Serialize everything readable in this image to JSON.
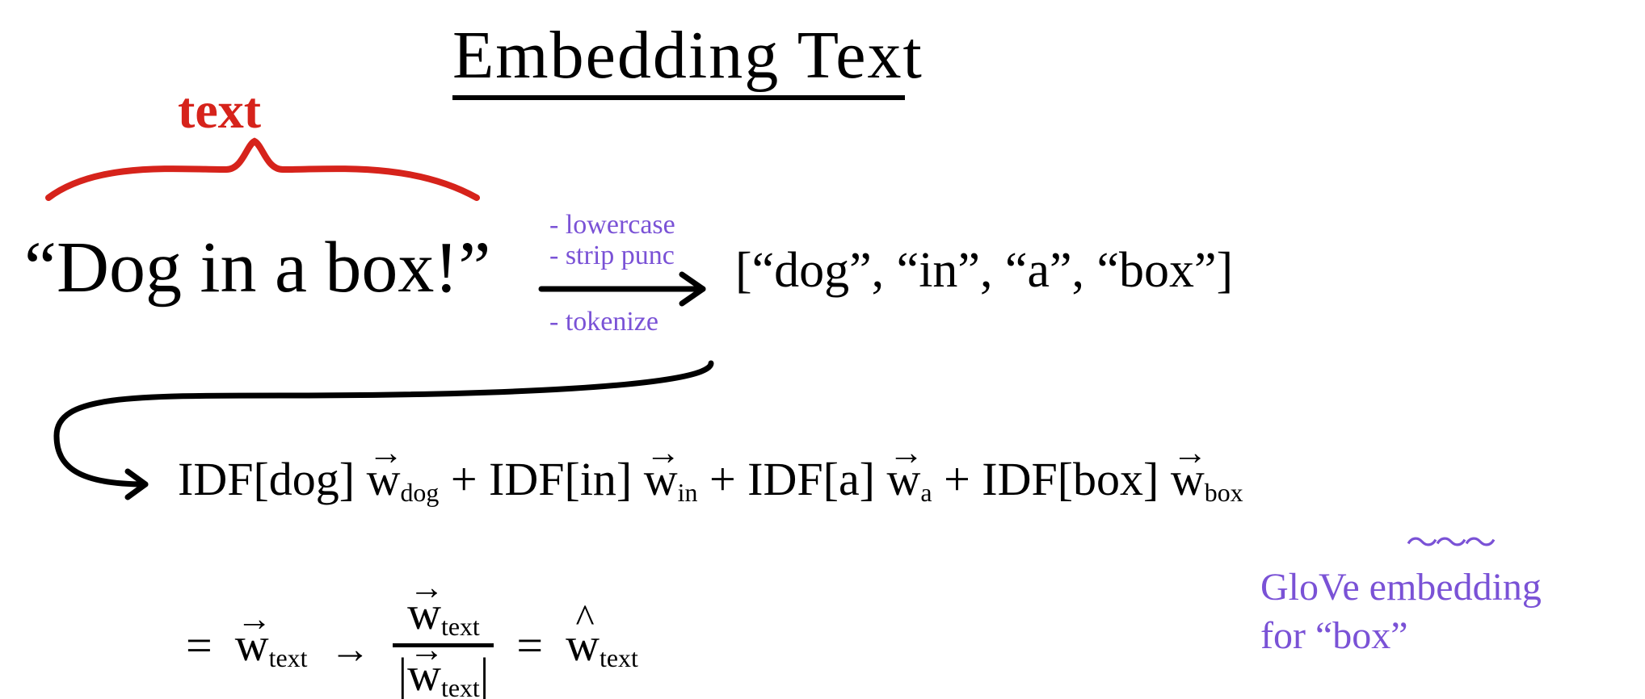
{
  "title": "Embedding Text",
  "label_text": "text",
  "input_phrase": "“Dog in a box!”",
  "processing": {
    "step1": "- lowercase",
    "step2": "- strip punc",
    "step3": "- tokenize"
  },
  "tokens_display": "[“dog”, “in”, “a”, “box”]",
  "tokens": [
    "dog",
    "in",
    "a",
    "box"
  ],
  "formula": {
    "idf_prefix": "IDF",
    "weight_symbol": "w̅",
    "terms": [
      "dog",
      "in",
      "a",
      "box"
    ],
    "plus": " + ",
    "result_name": "text"
  },
  "formula_line1_parts": {
    "t1a": "IDF[dog] ",
    "t1b": "w",
    "t1c": "dog",
    "t2a": "IDF[in] ",
    "t2b": "w",
    "t2c": "in",
    "t3a": "IDF[a] ",
    "t3b": "w",
    "t3c": "a",
    "t4a": "IDF[box] ",
    "t4b": "w",
    "t4c": "box"
  },
  "formula_line2": {
    "eq": "=",
    "w": "w",
    "text_sub": "text",
    "arrow": "→",
    "abs_open": "|",
    "abs_close": "|"
  },
  "annotation": {
    "glove_line1": "GloVe embedding",
    "glove_line2": "for “box”"
  },
  "squiggle": "～～～"
}
